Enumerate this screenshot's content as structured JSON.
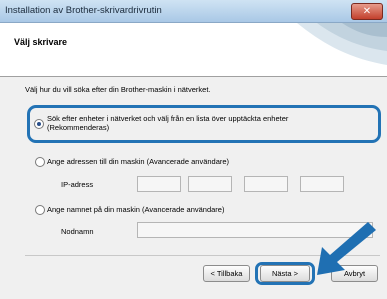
{
  "window": {
    "title": "Installation av Brother-skrivardrivrutin",
    "close_icon": "close-icon"
  },
  "header": {
    "title": "Välj skrivare"
  },
  "intro_text": "Välj hur du vill söka efter din Brother-maskin i nätverket.",
  "options": [
    {
      "label_line1": "Sök efter enheter i nätverket och välj från en lista över upptäckta enheter",
      "label_line2": "(Rekommenderas)",
      "selected": true
    },
    {
      "label": "Ange adressen till din maskin (Avancerade användare)",
      "selected": false
    },
    {
      "label": "Ange namnet på din maskin (Avancerade användare)",
      "selected": false
    }
  ],
  "ip_label": "IP-adress",
  "node_label": "Nodnamn",
  "buttons": {
    "back": "< Tillbaka",
    "next": "Nästa >",
    "cancel": "Avbryt"
  },
  "colors": {
    "highlight": "#2373b5",
    "arrow": "#1f6fb2"
  }
}
